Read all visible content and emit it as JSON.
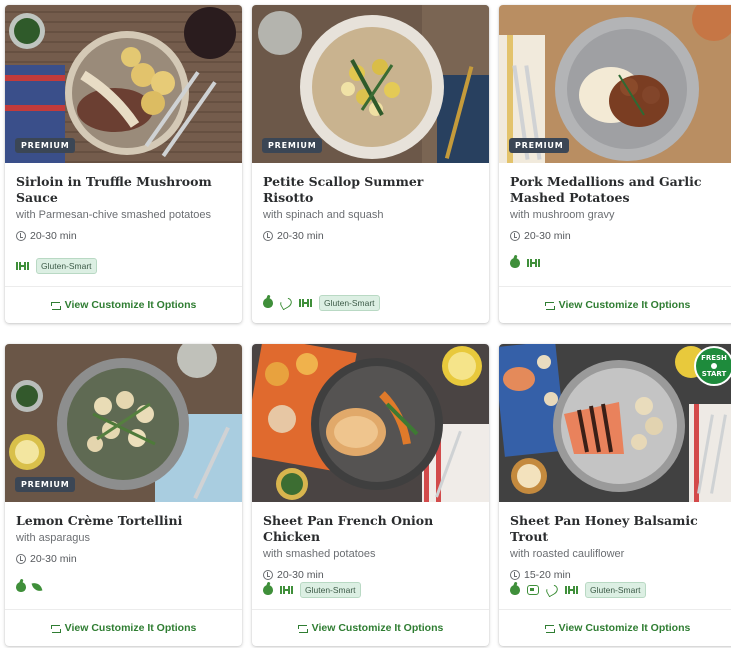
{
  "cards": [
    {
      "title": "Sirloin in Truffle Mushroom Sauce",
      "subtitle": "with Parmesan-chive smashed potatoes",
      "time": "20-30 min",
      "badge": "PREMIUM",
      "tag_pill": "Gluten-Smart",
      "cta": "View Customize It Options"
    },
    {
      "title": "Petite Scallop Summer Risotto",
      "subtitle": "with spinach and squash",
      "time": "20-30 min",
      "badge": "PREMIUM",
      "tag_pill": "Gluten-Smart"
    },
    {
      "title": "Pork Medallions and Garlic Mashed Potatoes",
      "subtitle": "with mushroom gravy",
      "time": "20-30 min",
      "badge": "PREMIUM",
      "cta": "View Customize It Options"
    },
    {
      "title": "Lemon Crème Tortellini",
      "subtitle": "with asparagus",
      "time": "20-30 min",
      "badge": "PREMIUM",
      "cta": "View Customize It Options"
    },
    {
      "title": "Sheet Pan French Onion Chicken",
      "subtitle": "with smashed potatoes",
      "time": "20-30 min",
      "tag_pill": "Gluten-Smart",
      "cta": "View Customize It Options"
    },
    {
      "title": "Sheet Pan Honey Balsamic Trout",
      "subtitle": "with roasted cauliflower",
      "time": "15-20 min",
      "tag_pill": "Gluten-Smart",
      "fresh_badge": [
        "FRESH",
        "START"
      ],
      "cta": "View Customize It Options"
    }
  ],
  "icons": {
    "badge_color": "#3b4655",
    "accent_green": "#2f7d32",
    "pill_bg": "#dcefe3"
  }
}
